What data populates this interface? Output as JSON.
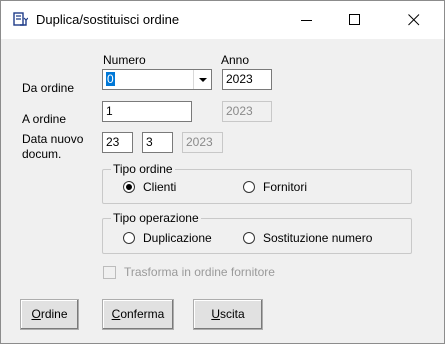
{
  "window": {
    "title": "Duplica/sostituisci ordine"
  },
  "headers": {
    "numero": "Numero",
    "anno": "Anno"
  },
  "rows": {
    "da_ordine": {
      "label": "Da ordine",
      "numero": "0",
      "anno": "2023"
    },
    "a_ordine": {
      "label": "A ordine",
      "numero": "1",
      "anno": "2023"
    },
    "data_nuovo": {
      "label_line1": "Data nuovo",
      "label_line2": "docum.",
      "giorno": "23",
      "mese": "3",
      "anno": "2023"
    }
  },
  "tipo_ordine": {
    "title": "Tipo ordine",
    "options": [
      {
        "label": "Clienti",
        "checked": true
      },
      {
        "label": "Fornitori",
        "checked": false
      }
    ]
  },
  "tipo_operazione": {
    "title": "Tipo operazione",
    "options": [
      {
        "label": "Duplicazione",
        "checked": false
      },
      {
        "label": "Sostituzione numero",
        "checked": false
      }
    ]
  },
  "trasforma": {
    "label": "Trasforma in ordine fornitore",
    "checked": false,
    "enabled": false
  },
  "buttons": {
    "ordine": {
      "mnemonic": "O",
      "rest": "rdine"
    },
    "conferma": {
      "mnemonic": "C",
      "rest": "onferma"
    },
    "uscita": {
      "mnemonic": "U",
      "rest": "scita"
    }
  }
}
